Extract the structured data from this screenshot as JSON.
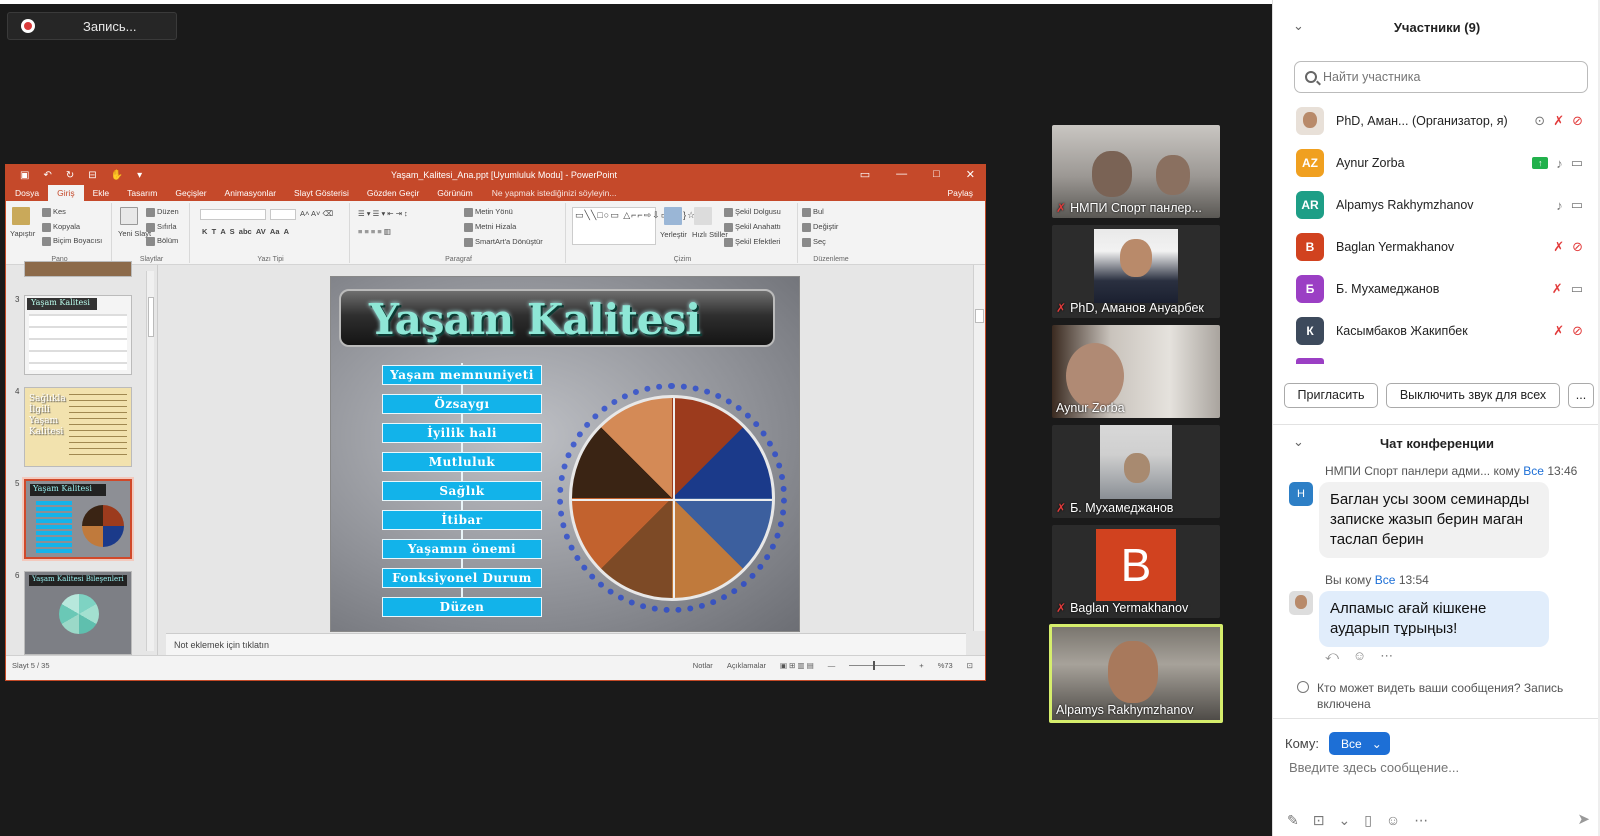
{
  "recording": {
    "label": "Запись..."
  },
  "ppt": {
    "window_title": "Yaşam_Kalitesi_Ana.ppt [Uyumluluk Modu] - PowerPoint",
    "menu": [
      "Dosya",
      "Giriş",
      "Ekle",
      "Tasarım",
      "Geçişler",
      "Animasyonlar",
      "Slayt Gösterisi",
      "Gözden Geçir",
      "Görünüm"
    ],
    "tell_me": "Ne yapmak istediğinizi söyleyin...",
    "share": "Paylaş",
    "ribbon": {
      "pano": "Pano",
      "paste": "Yapıştır",
      "cut": "Kes",
      "copy": "Kopyala",
      "format_painter": "Biçim Boyacısı",
      "slaytlar": "Slaytlar",
      "new_slide": "Yeni Slayt",
      "layout": "Düzen",
      "reset": "Sıfırla",
      "section": "Bölüm",
      "yazi_tipi": "Yazı Tipi",
      "paragraf": "Paragraf",
      "text_direction": "Metin Yönü",
      "align_text": "Metni Hizala",
      "smartart": "SmartArt'a Dönüştür",
      "cizim": "Çizim",
      "arrange": "Yerleştir",
      "quick_styles": "Hızlı Stiller",
      "shape_fill": "Şekil Dolgusu",
      "shape_outline": "Şekil Anahattı",
      "shape_effects": "Şekil Efektleri",
      "duzenleme": "Düzenleme",
      "find": "Bul",
      "replace": "Değiştir",
      "select": "Seç"
    },
    "thumbs": [
      {
        "num": "3",
        "title": "Yaşam Kalitesi"
      },
      {
        "num": "4",
        "title": "Sağlıkla İlgili Yaşam Kalitesi"
      },
      {
        "num": "5",
        "title": "Yaşam Kalitesi"
      },
      {
        "num": "6",
        "title": "Yaşam Kalitesi Bileşenleri"
      }
    ],
    "slide": {
      "title": "Yaşam Kalitesi",
      "items": [
        "Yaşam memnuniyeti",
        "Özsaygı",
        "İyilik hali",
        "Mutluluk",
        "Sağlık",
        "İtibar",
        "Yaşamın önemi",
        "Fonksiyonel Durum",
        "Düzen"
      ]
    },
    "notes": "Not eklemek için tıklatın",
    "status": {
      "slide": "Slayt 5 / 35",
      "notes": "Notlar",
      "comments": "Açıklamalar",
      "zoom": "%73"
    },
    "accent": "#c5492a"
  },
  "tiles": [
    {
      "name": "НМПИ Спорт панлер...",
      "muted": true
    },
    {
      "name": "PhD, Аманов Ануарбек",
      "muted": true
    },
    {
      "name": "Aynur Zorba",
      "muted": false
    },
    {
      "name": "Б. Мухамеджанов",
      "muted": true
    },
    {
      "name": "Baglan Yermakhanov",
      "muted": true,
      "avatar": "B"
    },
    {
      "name": "Alpamys Rakhymzhanov",
      "muted": false
    }
  ],
  "participants": {
    "title": "Участники (9)",
    "search_placeholder": "Найти участника",
    "list": [
      {
        "name": "PhD, Аман...",
        "role": "(Организатор, я)",
        "avatar": "",
        "color": "#ffffff"
      },
      {
        "name": "Aynur Zorba",
        "avatar": "AZ",
        "color": "#f0a020"
      },
      {
        "name": "Alpamys Rakhymzhanov",
        "avatar": "AR",
        "color": "#1e9e86"
      },
      {
        "name": "Baglan Yermakhanov",
        "avatar": "B",
        "color": "#d1421f"
      },
      {
        "name": "Б. Мухамеджанов",
        "avatar": "Б",
        "color": "#9b3fc4"
      },
      {
        "name": "Касымбаков Жакипбек",
        "avatar": "К",
        "color": "#3d4a5c"
      }
    ],
    "invite": "Пригласить",
    "mute_all": "Выключить звук для всех",
    "more": "..."
  },
  "chat": {
    "title": "Чат конференции",
    "messages": [
      {
        "from": "НМПИ Спорт панлери адми...",
        "to_word": "кому",
        "to": "Все",
        "time": "13:46",
        "avatar": "Н",
        "text": "Баглан усы зоом семинарды записке жазып берин маган таслап берин"
      },
      {
        "from": "Вы",
        "to_word": "кому",
        "to": "Все",
        "time": "13:54",
        "text": "Алпамыс ағай кішкене аударып тұрыңыз!"
      }
    ],
    "who_can_see": "Кто может видеть ваши сообщения? Запись включена",
    "to_label": "Кому:",
    "to_value": "Все",
    "input_placeholder": "Введите здесь сообщение..."
  }
}
